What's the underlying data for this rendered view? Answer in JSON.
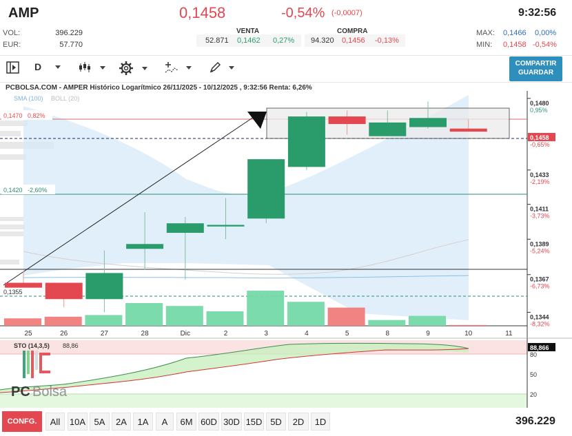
{
  "header": {
    "ticker": "AMP",
    "price": "0,1458",
    "change_pct": "-0,54%",
    "change_abs": "(-0,0007)",
    "time": "9:32:56",
    "vol_label": "VOL:",
    "vol_value": "396.229",
    "eur_label": "EUR:",
    "eur_value": "57.770",
    "venta_label": "VENTA",
    "compra_label": "COMPRA",
    "venta": {
      "qty": "52.871",
      "price": "0,1462",
      "pct": "0,27%"
    },
    "compra": {
      "qty": "94.320",
      "price": "0,1456",
      "pct": "-0,13%"
    },
    "max_label": "MAX:",
    "max_price": "0,1466",
    "max_pct": "0,00%",
    "min_label": "MIN:",
    "min_price": "0,1458",
    "min_pct": "-0,54%"
  },
  "toolbar": {
    "period": "D",
    "share_line1": "COMPARTIR",
    "share_line2": "GUARDAR",
    "icons": [
      "panel-toggle-icon",
      "candles-icon",
      "gear-icon",
      "indicators-icon",
      "pencil-icon"
    ]
  },
  "chart": {
    "title": "PCBOLSA.COM - AMPER Histórico Logarítmico 26/11/2025 - 10/12/2025 , 9:32:56 Renta: 6,26%",
    "sma_label": "SMA (100)",
    "boll_label": "BOLL (20)",
    "level_top": "0,1470",
    "level_top_pct": "0,82%",
    "level_mid": "0,1420",
    "level_mid_pct": "-2,60%",
    "level_low": "0,1355",
    "current_price_tag": "0,1458",
    "current_pct_tag": "-0,65%",
    "right_axis": [
      {
        "price": "0,1480",
        "pct": "0,95%"
      },
      {
        "price": "0,1433",
        "pct": "-2,19%"
      },
      {
        "price": "0,1411",
        "pct": "-3,73%"
      },
      {
        "price": "0,1389",
        "pct": "-5,24%"
      },
      {
        "price": "0,1367",
        "pct": "-6,73%"
      },
      {
        "price": "0,1344",
        "pct": "-8,32%"
      }
    ],
    "x_labels": [
      "25",
      "26",
      "27",
      "28",
      "Dic",
      "2",
      "3",
      "4",
      "5",
      "8",
      "9",
      "10",
      "11"
    ],
    "sto_label": "STO (14,3,5)",
    "sto_value": "88,86",
    "sto_tag": "88,866",
    "sto_axis": [
      "80",
      "50",
      "20"
    ],
    "watermark_left": "PC",
    "watermark_right": "Bolsa"
  },
  "chart_data": {
    "type": "candlestick",
    "title": "PCBOLSA.COM - AMPER Histórico Logarítmico 26/11/2025 - 10/12/2025 , 9:32:56 Renta: 6,26%",
    "categories": [
      "25",
      "26",
      "27",
      "28",
      "Dic",
      "2",
      "3",
      "4",
      "5",
      "8",
      "9",
      "10"
    ],
    "ohlc": [
      {
        "open": 0.1362,
        "high": 0.1369,
        "low": 0.1359,
        "close": 0.1359
      },
      {
        "open": 0.1362,
        "high": 0.1362,
        "low": 0.1347,
        "close": 0.1352
      },
      {
        "open": 0.1352,
        "high": 0.1382,
        "low": 0.1344,
        "close": 0.1368
      },
      {
        "open": 0.1383,
        "high": 0.1406,
        "low": 0.137,
        "close": 0.1386
      },
      {
        "open": 0.1393,
        "high": 0.1403,
        "low": 0.1364,
        "close": 0.1399
      },
      {
        "open": 0.1397,
        "high": 0.1415,
        "low": 0.1389,
        "close": 0.1398
      },
      {
        "open": 0.1402,
        "high": 0.144,
        "low": 0.1399,
        "close": 0.144
      },
      {
        "open": 0.1435,
        "high": 0.1471,
        "low": 0.1433,
        "close": 0.1468
      },
      {
        "open": 0.1468,
        "high": 0.1472,
        "low": 0.1456,
        "close": 0.1463
      },
      {
        "open": 0.1455,
        "high": 0.1472,
        "low": 0.1455,
        "close": 0.1464
      },
      {
        "open": 0.1461,
        "high": 0.1478,
        "low": 0.146,
        "close": 0.1467
      },
      {
        "open": 0.146,
        "high": 0.1466,
        "low": 0.1458,
        "close": 0.1458
      }
    ],
    "volume_relative": [
      0.18,
      0.22,
      0.26,
      0.55,
      0.48,
      0.35,
      0.85,
      0.58,
      0.44,
      0.14,
      0.24,
      0.02
    ],
    "stochastic": [
      32,
      35,
      42,
      50,
      60,
      65,
      75,
      81,
      86,
      88,
      89,
      88.86
    ],
    "ylim": [
      0.134,
      0.1485
    ],
    "y_scale": "log"
  }
}
